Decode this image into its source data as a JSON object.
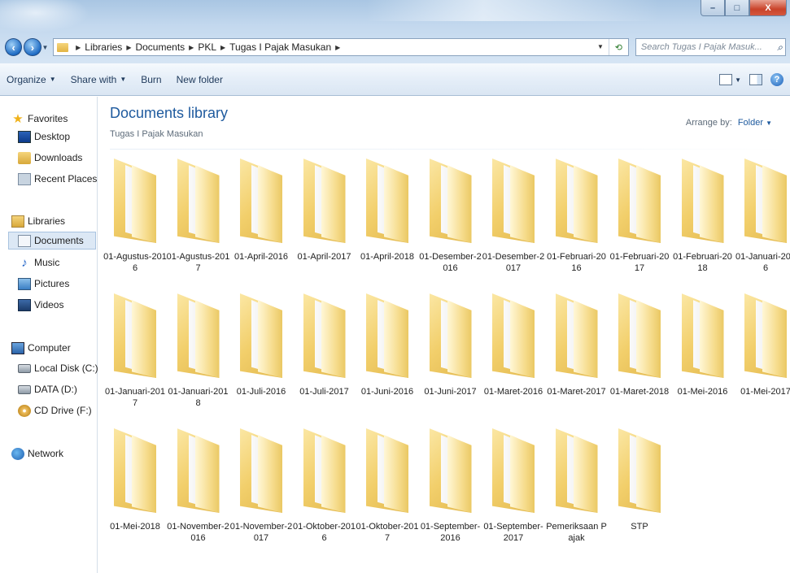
{
  "window": {
    "buttons": {
      "minimize": "–",
      "maximize": "□",
      "close": "X"
    }
  },
  "address": {
    "crumbs": [
      "Libraries",
      "Documents",
      "PKL",
      "Tugas I Pajak Masukan"
    ],
    "search_placeholder": "Search Tugas I Pajak Masuk..."
  },
  "commandbar": {
    "organize": "Organize",
    "share_with": "Share with",
    "burn": "Burn",
    "new_folder": "New folder"
  },
  "sidebar": {
    "favorites": {
      "label": "Favorites",
      "items": [
        "Desktop",
        "Downloads",
        "Recent Places"
      ]
    },
    "libraries": {
      "label": "Libraries",
      "items": [
        "Documents",
        "Music",
        "Pictures",
        "Videos"
      ]
    },
    "computer": {
      "label": "Computer",
      "items": [
        "Local Disk (C:)",
        "DATA (D:)",
        "CD Drive (F:)"
      ]
    },
    "network": {
      "label": "Network"
    },
    "selected": "Documents"
  },
  "content": {
    "title": "Documents library",
    "subtitle": "Tugas I Pajak Masukan",
    "arrange_label": "Arrange by:",
    "arrange_value": "Folder",
    "folders": [
      "01-Agustus-2016",
      "01-Agustus-2017",
      "01-April-2016",
      "01-April-2017",
      "01-April-2018",
      "01-Desember-2016",
      "01-Desember-2017",
      "01-Februari-2016",
      "01-Februari-2017",
      "01-Februari-2018",
      "01-Januari-2016",
      "01-Januari-2017",
      "01-Januari-2018",
      "01-Juli-2016",
      "01-Juli-2017",
      "01-Juni-2016",
      "01-Juni-2017",
      "01-Maret-2016",
      "01-Maret-2017",
      "01-Maret-2018",
      "01-Mei-2016",
      "01-Mei-2017",
      "01-Mei-2018",
      "01-November-2016",
      "01-November-2017",
      "01-Oktober-2016",
      "01-Oktober-2017",
      "01-September-2016",
      "01-September-2017",
      "Pemeriksaan Pajak",
      "STP"
    ]
  },
  "colors": {
    "title_blue": "#1e5a9e",
    "folder_yellow": "#f2cf6b",
    "selection": "#dce8f5"
  }
}
